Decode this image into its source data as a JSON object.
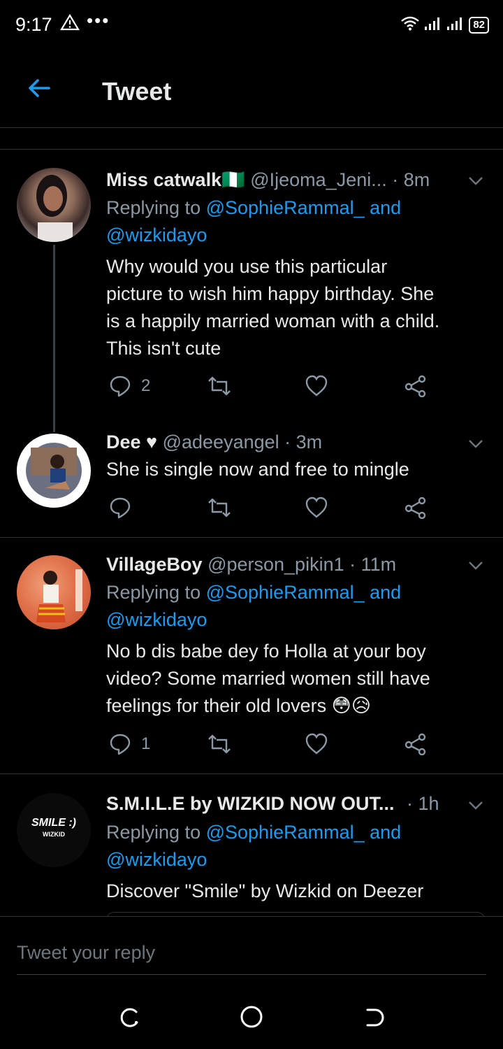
{
  "status_bar": {
    "time": "9:17",
    "battery": "82"
  },
  "header": {
    "title": "Tweet"
  },
  "tweets": [
    {
      "name": "Miss catwalk",
      "flag": "🇳🇬",
      "handle": "@Ijeoma_Jeni...",
      "time": "· 8m",
      "replying_prefix": "Replying to",
      "reply_to_1": "@SophieRammal_",
      "reply_and": "and",
      "reply_to_2": "@wizkidayo",
      "text_lines": [
        "Why would you use this particular",
        "picture to wish him happy birthday. She",
        "is a happily married woman with a child.",
        "This isn't cute"
      ],
      "reply_count": "2",
      "retweet_count": "",
      "like_count": ""
    },
    {
      "name": "Dee ♥",
      "handle": "@adeeyangel",
      "time": "· 3m",
      "text_lines": [
        "She is single now and free to mingle"
      ],
      "reply_count": "",
      "retweet_count": "",
      "like_count": ""
    },
    {
      "name": "VillageBoy",
      "handle": "@person_pikin1",
      "time": "· 11m",
      "replying_prefix": "Replying to",
      "reply_to_1": "@SophieRammal_",
      "reply_and": "and",
      "reply_to_2": "@wizkidayo",
      "text_lines": [
        "No b dis babe dey fo Holla at your boy",
        "video? Some married women still have",
        "feelings for their old lovers"
      ],
      "emoji": "😳😥",
      "reply_count": "1",
      "retweet_count": "",
      "like_count": ""
    },
    {
      "name": "S.M.I.L.E by WIZKID NOW OUT...",
      "handle": "",
      "time": "· 1h",
      "replying_prefix": "Replying to",
      "reply_to_1": "@SophieRammal_",
      "reply_and": "and",
      "reply_to_2": "@wizkidayo",
      "text_lines": [
        "Discover \"Smile\" by Wizkid on Deezer"
      ],
      "avatar_text": "SMILE :)",
      "avatar_sub": "WIZKID"
    }
  ],
  "reply_box": {
    "placeholder": "Tweet your reply"
  },
  "colors": {
    "accent": "#1d9bf0",
    "muted": "#8b98a5",
    "bg": "#000000",
    "divider": "#2f3336"
  },
  "icons": [
    "back-arrow-icon",
    "reply-icon",
    "retweet-icon",
    "like-icon",
    "share-icon",
    "chevron-down-icon"
  ]
}
